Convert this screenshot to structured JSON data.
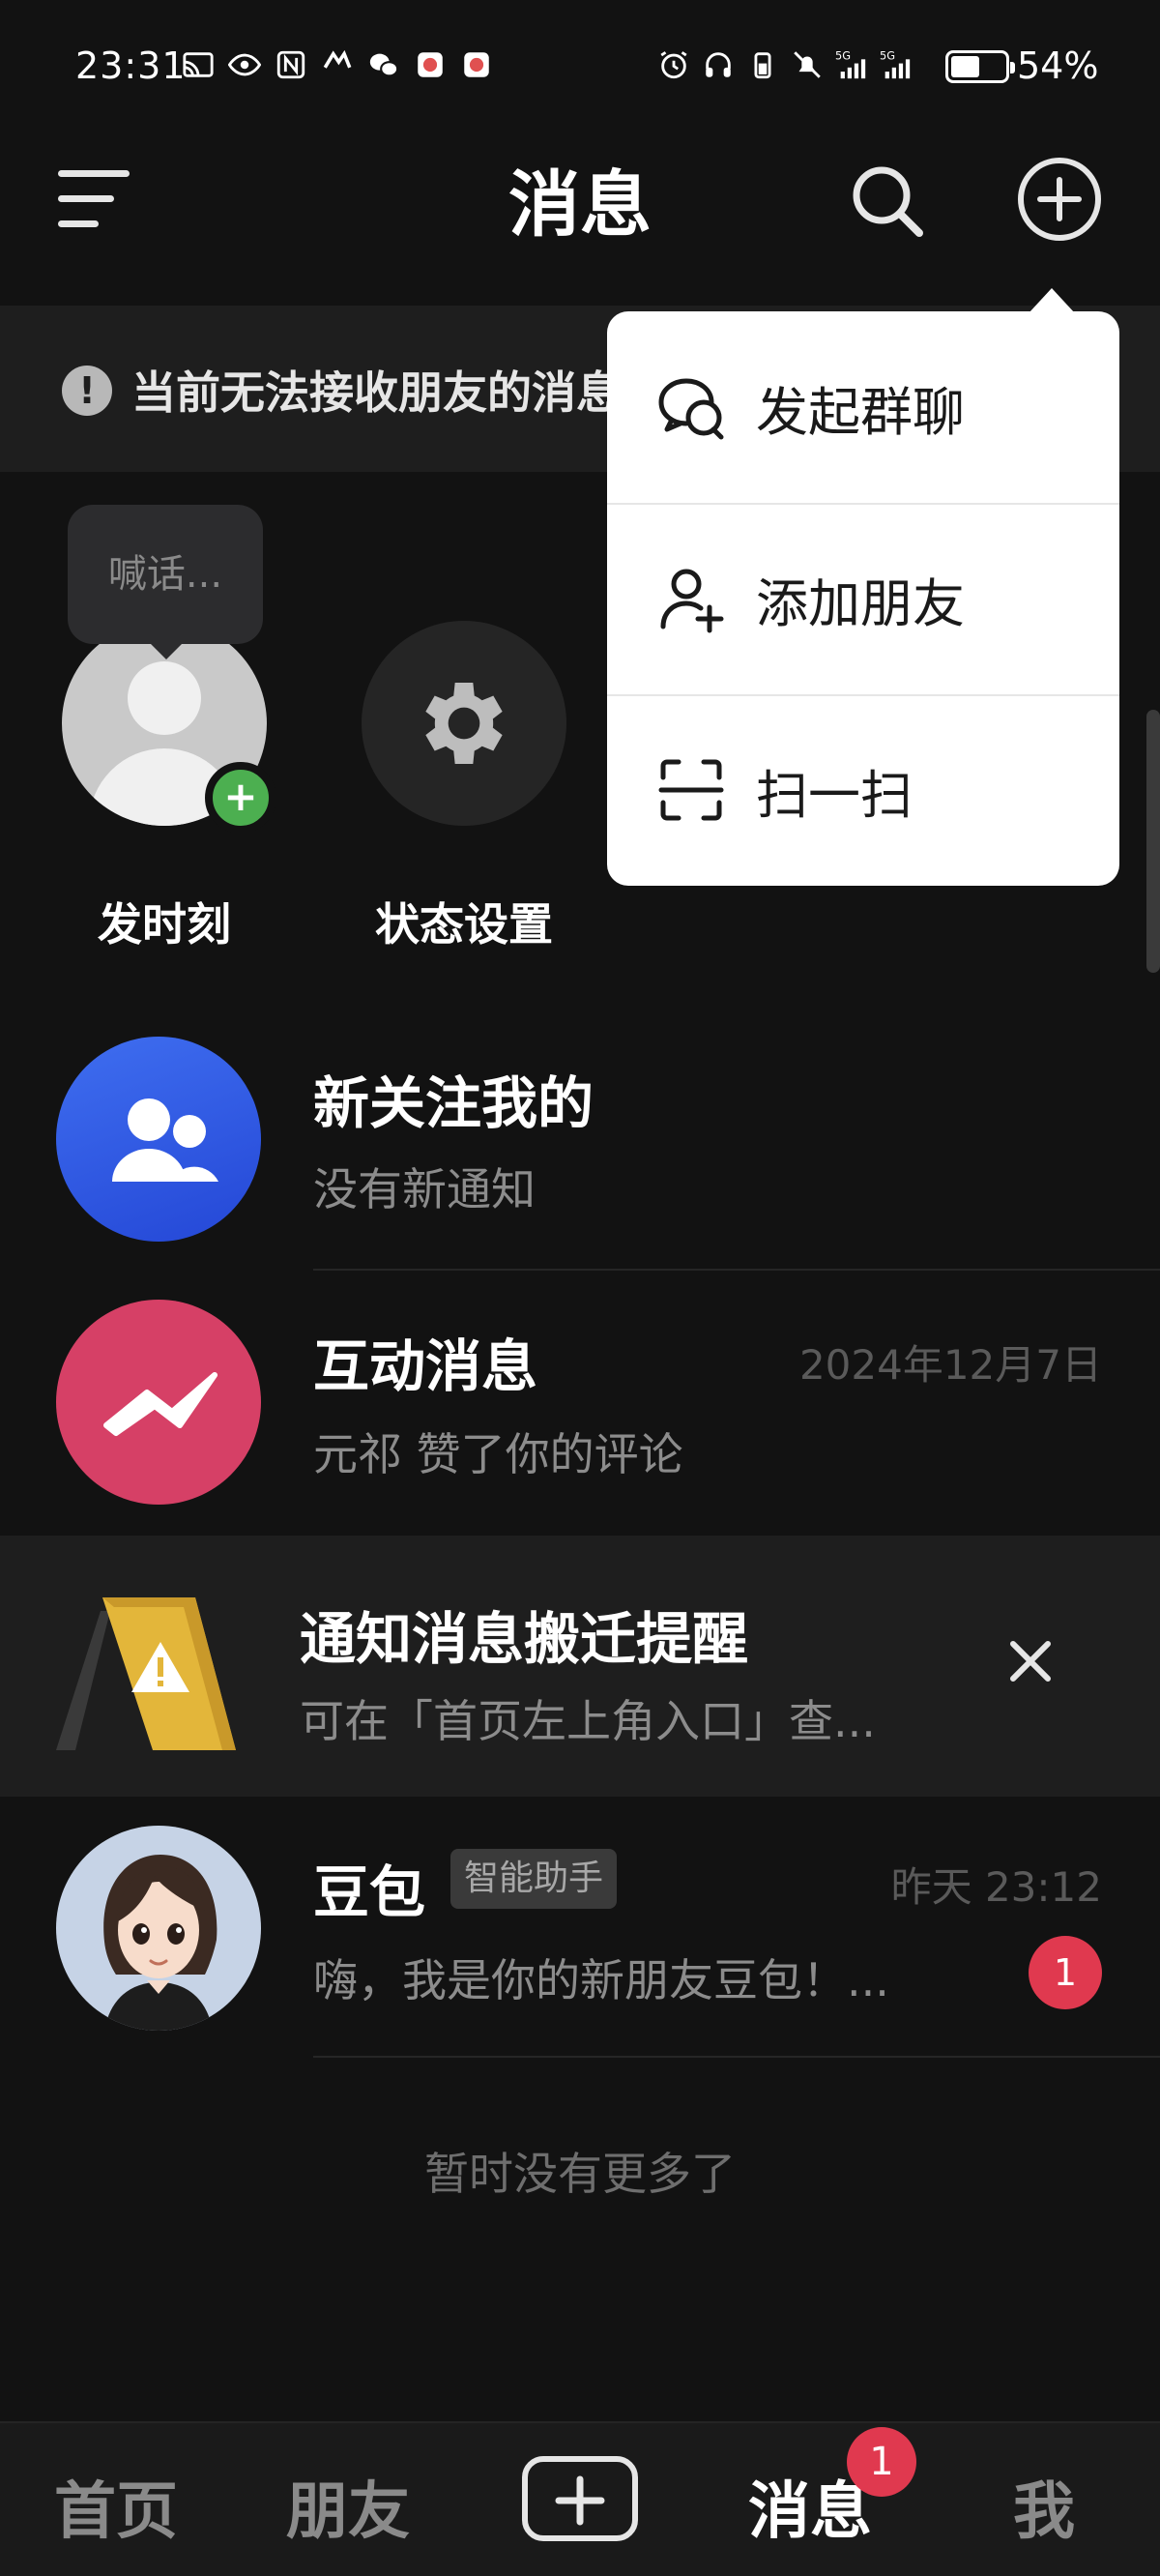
{
  "status_bar": {
    "time": "23:31",
    "battery_percent": "54%",
    "battery_level": 0.54,
    "signal_label_1": "5G",
    "signal_label_2": "5G"
  },
  "header": {
    "title": "消息"
  },
  "warning": {
    "text": "当前无法接收朋友的消息"
  },
  "quick_actions": {
    "bubble_text": "喊话...",
    "post_moment_label": "发时刻",
    "status_settings_label": "状态设置"
  },
  "messages": [
    {
      "title": "新关注我的",
      "subtitle": "没有新通知",
      "time": ""
    },
    {
      "title": "互动消息",
      "subtitle": "元祁 赞了你的评论",
      "time": "2024年12月7日"
    }
  ],
  "notice": {
    "title": "通知消息搬迁提醒",
    "subtitle": "可在「首页左上角入口」查..."
  },
  "doubao": {
    "name": "豆包",
    "badge": "智能助手",
    "time": "昨天 23:12",
    "preview": "嗨，我是你的新朋友豆包！...",
    "unread": "1"
  },
  "footer_text": "暂时没有更多了",
  "dropdown": {
    "items": [
      {
        "label": "发起群聊",
        "icon": "group-chat-icon"
      },
      {
        "label": "添加朋友",
        "icon": "add-friend-icon"
      },
      {
        "label": "扫一扫",
        "icon": "scan-icon"
      }
    ]
  },
  "bottom_nav": {
    "home": "首页",
    "friends": "朋友",
    "messages": "消息",
    "me": "我",
    "messages_badge": "1"
  },
  "colors": {
    "background": "#121212",
    "accent_red": "#e0394f",
    "fan_blue": "#3f6ef0",
    "interact_pink": "#e0456e",
    "green": "#4caf50"
  }
}
